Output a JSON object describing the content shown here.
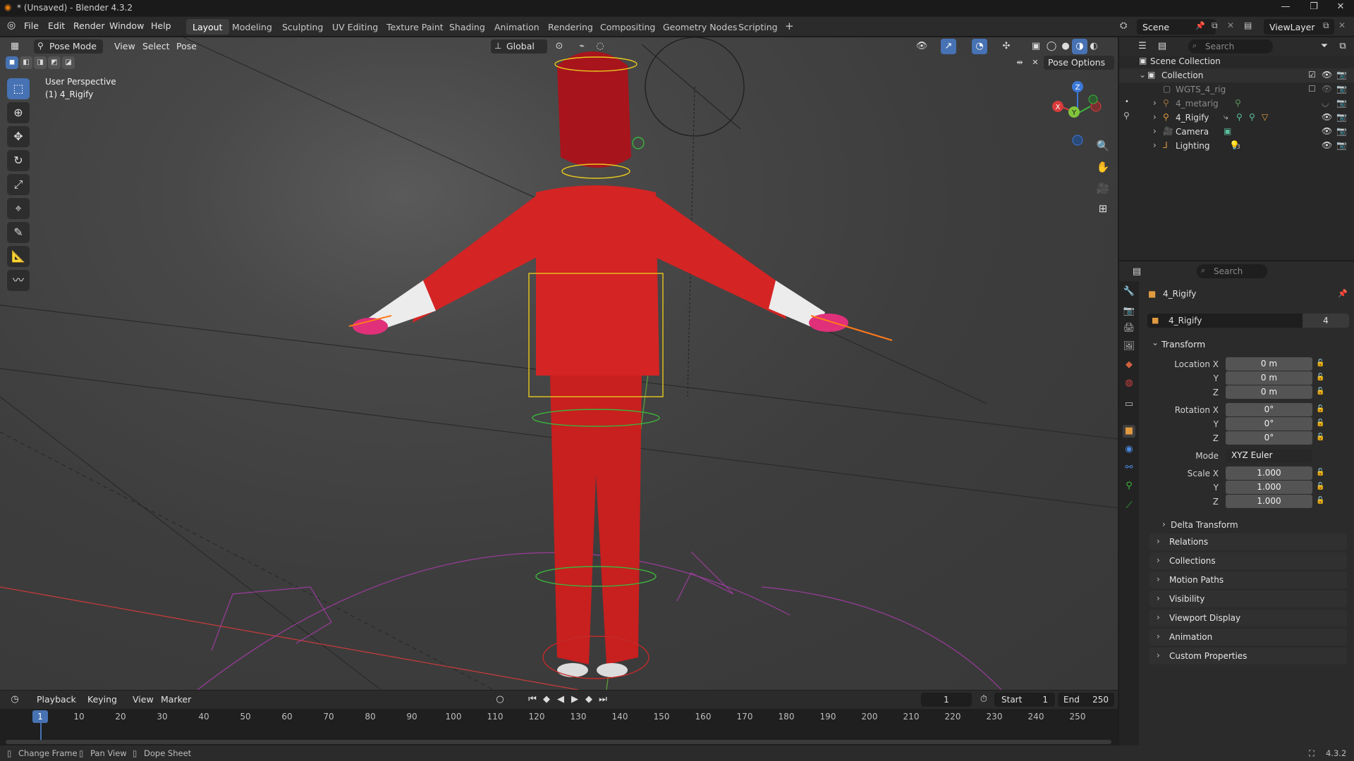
{
  "window": {
    "title": "* (Unsaved) - Blender 4.3.2",
    "controls": [
      "—",
      "❐",
      "✕"
    ]
  },
  "menus": [
    "File",
    "Edit",
    "Render",
    "Window",
    "Help"
  ],
  "workspaces": [
    "Layout",
    "Modeling",
    "Sculpting",
    "UV Editing",
    "Texture Paint",
    "Shading",
    "Animation",
    "Rendering",
    "Compositing",
    "Geometry Nodes",
    "Scripting"
  ],
  "workspace_add": "+",
  "scene": {
    "name": "Scene",
    "view_layer": "ViewLayer"
  },
  "viewport_header": {
    "mode": "Pose Mode",
    "menus": [
      "View",
      "Select",
      "Pose"
    ],
    "orientation": "Global",
    "pose_options": "Pose Options"
  },
  "viewport": {
    "view_name": "User Perspective",
    "object_label": "(1) 4_Rigify",
    "axis_labels": {
      "x": "X",
      "y": "Y",
      "z": "Z"
    }
  },
  "outliner": {
    "search_placeholder": "Search",
    "rows": [
      {
        "label": "Scene Collection"
      },
      {
        "label": "Collection"
      },
      {
        "label": "WGTS_4_rig"
      },
      {
        "label": "4_metarig"
      },
      {
        "label": "4_Rigify"
      },
      {
        "label": "Camera"
      },
      {
        "label": "Lighting"
      }
    ],
    "lighting_count": "3"
  },
  "properties": {
    "search_placeholder": "Search",
    "object_name": "4_Rigify",
    "datablock_name": "4_Rigify",
    "users": "4",
    "transform": {
      "title": "Transform",
      "location_label": "Location X",
      "location": [
        "0 m",
        "0 m",
        "0 m"
      ],
      "rotation_label": "Rotation X",
      "rotation": [
        "0°",
        "0°",
        "0°"
      ],
      "mode_label": "Mode",
      "mode": "XYZ Euler",
      "scale_label": "Scale X",
      "scale": [
        "1.000",
        "1.000",
        "1.000"
      ],
      "axis_y": "Y",
      "axis_z": "Z"
    },
    "delta_transform": "Delta Transform",
    "panels": [
      "Relations",
      "Collections",
      "Motion Paths",
      "Visibility",
      "Viewport Display",
      "Animation",
      "Custom Properties"
    ]
  },
  "timeline": {
    "menus": [
      "Playback",
      "Keying",
      "View",
      "Marker"
    ],
    "current_frame": "1",
    "start_label": "Start",
    "start": "1",
    "end_label": "End",
    "end": "250",
    "ruler_ticks": [
      "10",
      "20",
      "30",
      "40",
      "50",
      "60",
      "70",
      "80",
      "90",
      "100",
      "110",
      "120",
      "130",
      "140",
      "150",
      "160",
      "170",
      "180",
      "190",
      "200",
      "210",
      "220",
      "230",
      "240",
      "250"
    ],
    "playhead": "1"
  },
  "statusbar": {
    "hints": [
      "Change Frame",
      "Pan View",
      "Dope Sheet"
    ],
    "version": "4.3.2"
  },
  "colors": {
    "accent": "#4772b3",
    "character_red": "#d42424",
    "bone_yellow": "#e8c81c",
    "bone_green": "#3cb43c"
  }
}
